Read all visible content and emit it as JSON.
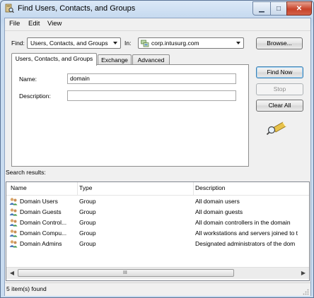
{
  "window": {
    "title": "Find Users, Contacts, and Groups",
    "controls": {
      "minimize": "▁",
      "maximize": "□",
      "close": "✕"
    }
  },
  "menu": [
    "File",
    "Edit",
    "View"
  ],
  "search_bar": {
    "find_label": "Find:",
    "find_value": "Users, Contacts, and Groups",
    "in_label": "In:",
    "in_value": "corp.intusurg.com",
    "browse_label": "Browse..."
  },
  "tabs": [
    "Users, Contacts, and Groups",
    "Exchange",
    "Advanced"
  ],
  "form": {
    "name_label": "Name:",
    "name_value": "domain",
    "description_label": "Description:",
    "description_value": ""
  },
  "actions": {
    "find_now": "Find Now",
    "stop": "Stop",
    "clear_all": "Clear All"
  },
  "results": {
    "label": "Search results:",
    "columns": [
      "Name",
      "Type",
      "Description"
    ],
    "rows": [
      {
        "name": "Domain Users",
        "type": "Group",
        "description": "All domain users"
      },
      {
        "name": "Domain Guests",
        "type": "Group",
        "description": "All domain guests"
      },
      {
        "name": "Domain Control...",
        "type": "Group",
        "description": "All domain controllers in the domain"
      },
      {
        "name": "Domain Compu...",
        "type": "Group",
        "description": "All workstations and servers joined to t"
      },
      {
        "name": "Domain Admins",
        "type": "Group",
        "description": "Designated administrators of the dom"
      }
    ],
    "scroll_grip": "III"
  },
  "status": {
    "text": "5 item(s) found"
  },
  "icons": {
    "app": "directory-search-icon",
    "domain": "domain-icon",
    "group": "group-icon",
    "search_graphic": "magnifier-flashlight-icon"
  },
  "colors": {
    "accent": "#3c7fb1",
    "close": "#c8432a"
  }
}
